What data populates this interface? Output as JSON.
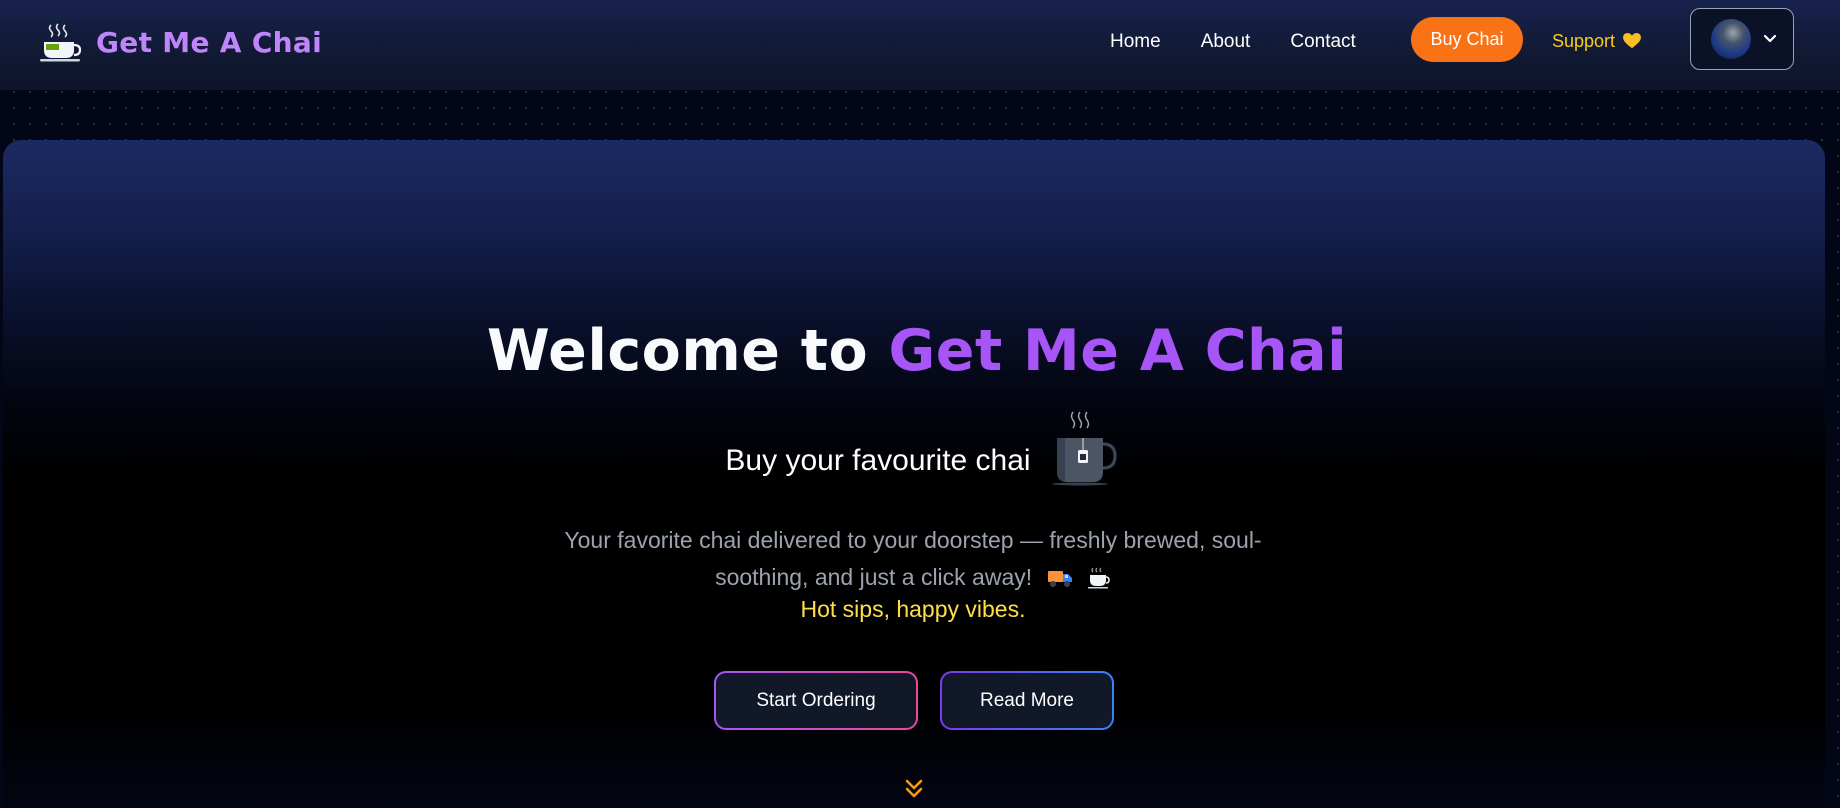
{
  "navbar": {
    "brand": "Get Me A Chai",
    "links": {
      "home": "Home",
      "about": "About",
      "contact": "Contact"
    },
    "buy_button": "Buy Chai",
    "support_link": "Support",
    "icons": {
      "brand": "tea-cup-icon",
      "support": "yellow-heart-icon",
      "profile_dropdown": "chevron-down-icon"
    }
  },
  "hero": {
    "title_prefix": "Welcome to",
    "title_accent": "Get Me A Chai",
    "subtitle": "Buy your favourite chai",
    "description": "Your favorite chai delivered to your doorstep — freshly brewed, soul-soothing, and just a click away!",
    "tagline": "Hot sips, happy vibes.",
    "buttons": {
      "start": "Start Ordering",
      "read": "Read More"
    },
    "icons": {
      "subtitle": "tea-mug-icon",
      "description": [
        "delivery-truck-icon",
        "tea-cup-icon"
      ],
      "scroll": "double-chevron-down-icon"
    }
  },
  "colors": {
    "brand": "#c084fc",
    "accent": "#a855f7",
    "buy_button": "#f97316",
    "support": "#facc15",
    "tagline": "#fde047"
  }
}
